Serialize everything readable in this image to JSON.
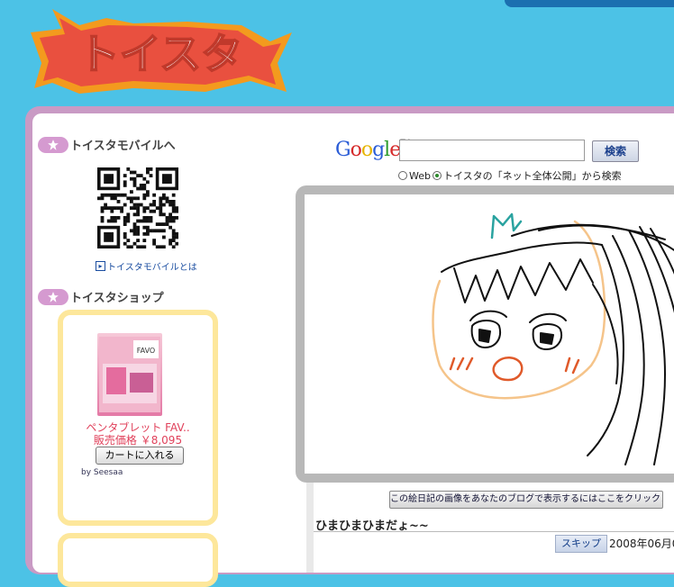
{
  "site": {
    "logo_text": "トイスタ"
  },
  "sidebar": {
    "mobile": {
      "title": "トイスタモバイルへ",
      "link": "トイスタモバイルとは"
    },
    "shop": {
      "title": "トイスタショップ",
      "product": {
        "name": "ペンタブレット FAV..",
        "box_text": "FAVO",
        "price": "販売価格 ￥8,095",
        "cart_label": "カートに入れる",
        "by": "by Seesaa"
      }
    }
  },
  "search": {
    "google_label": "Google",
    "google_tm": "TM",
    "button_label": "検索",
    "input_value": "",
    "options": [
      {
        "label": "Web",
        "selected": false
      },
      {
        "label": "トイスタの「ネット全体公開」から検索",
        "selected": true
      }
    ]
  },
  "diary": {
    "blog_button": "この絵日記の画像をあなたのブログで表示するにはここをクリック！",
    "title": "ひまひまひまだょ~~",
    "skip_label": "スキップ",
    "date": "2008年06月0"
  },
  "colors": {
    "background": "#4cc2e6",
    "frame": "#c99ac4",
    "shop_border": "#fde79b",
    "logo_orange": "#f39a1e",
    "price_red": "#e0405a"
  }
}
